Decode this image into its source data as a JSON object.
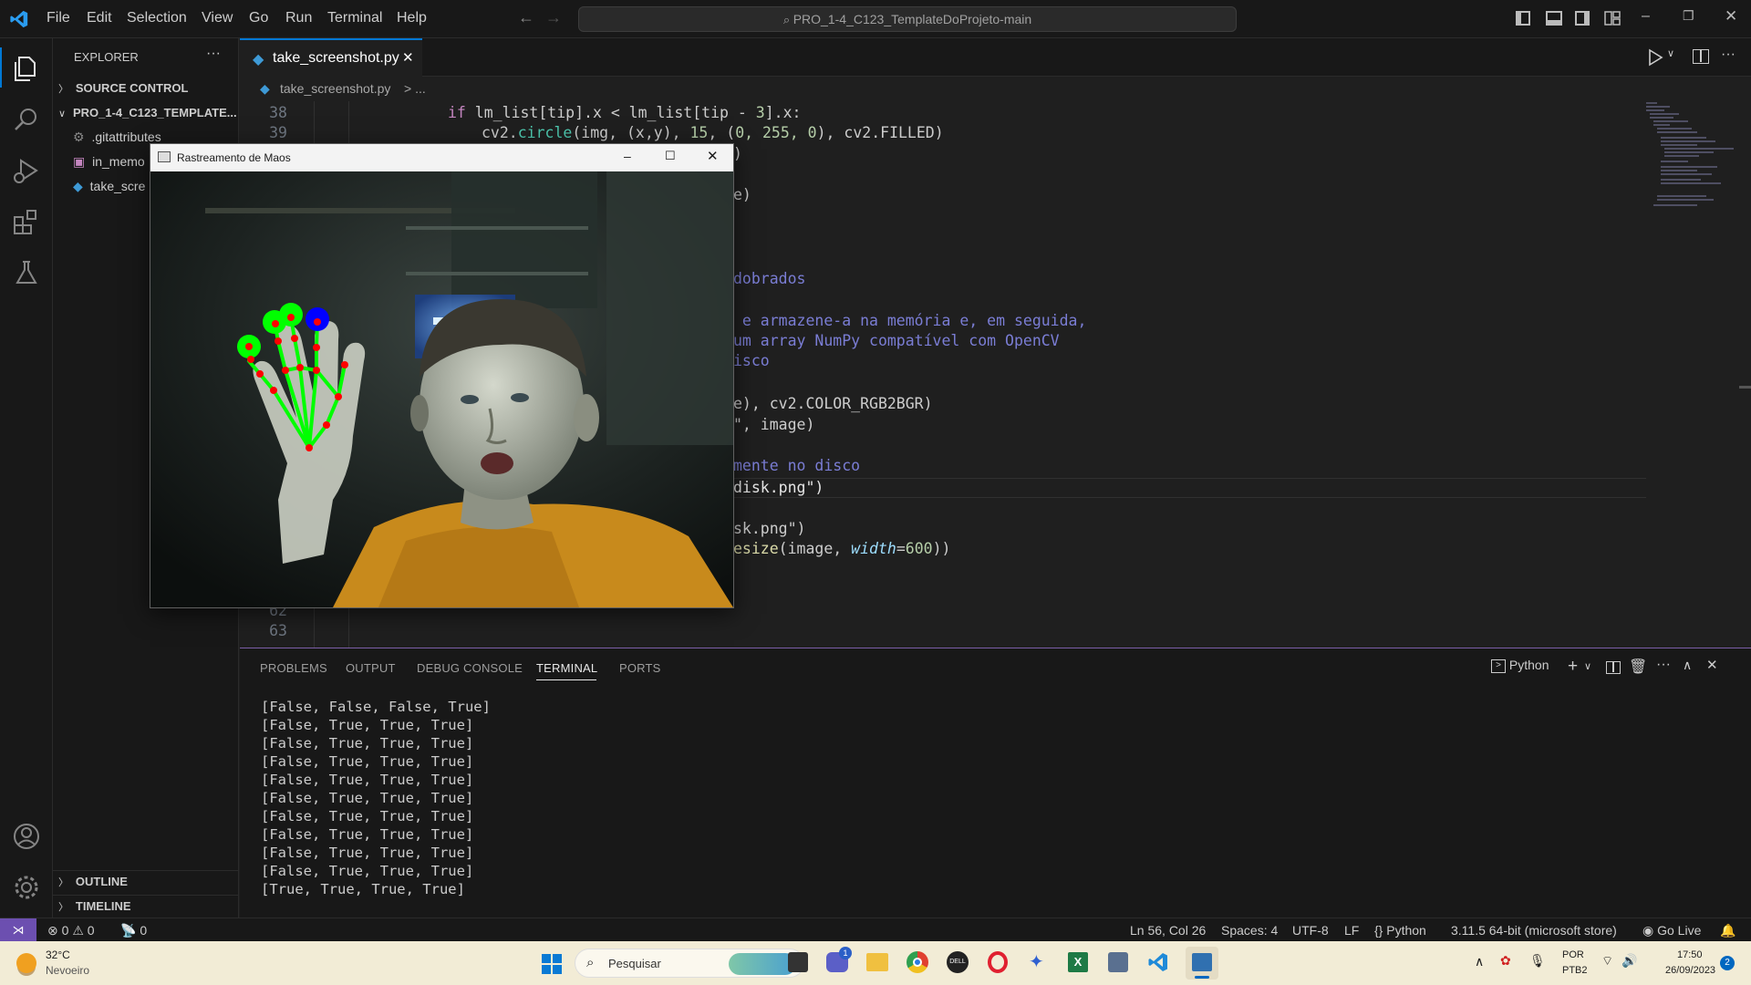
{
  "titlebar": {
    "menus": [
      "File",
      "Edit",
      "Selection",
      "View",
      "Go",
      "Run",
      "Terminal",
      "Help"
    ],
    "search_text": "PRO_1-4_C123_TemplateDoProjeto-main"
  },
  "sidebar": {
    "header": "EXPLORER",
    "more": "···",
    "source_control": "SOURCE CONTROL",
    "project": "PRO_1-4_C123_TEMPLATE...",
    "files": [
      ".gitattributes",
      "in_memo",
      "take_scre"
    ],
    "outline": "OUTLINE",
    "timeline": "TIMELINE"
  },
  "editor": {
    "tab_label": "take_screenshot.py",
    "breadcrumb_file": "take_screenshot.py",
    "breadcrumb_sep": "> ...",
    "line_numbers": [
      "38",
      "39",
      "62",
      "63"
    ],
    "code": {
      "l38_a": "if",
      "l38_b": " lm_list[tip].x < lm_list[tip - ",
      "l38_c": "3",
      "l38_d": "].x:",
      "l39_a": "cv2.",
      "l39_b": "circle",
      "l39_c": "(img, (x,y), ",
      "l39_d": "15",
      "l39_e": ", (",
      "l39_f": "0, 255, 0",
      "l39_g": "), cv2.FILLED)",
      "l40": ")",
      "l42": "e)",
      "l46": "dobrados",
      "l48": " e armazene-a na memória e, em seguida,",
      "l49": "um array NumPy compatível com OpenCV",
      "l50": "isco",
      "l52": "e), cv2.COLOR_RGB2BGR)",
      "l53": "\", image)",
      "l55": "mente no disco",
      "l56": "disk.png\")",
      "l58": "sk.png\")",
      "l59_a": "esize",
      "l59_b": "(image, ",
      "l59_c": "width",
      "l59_d": "=",
      "l59_e": "600",
      "l59_f": "))"
    }
  },
  "panel": {
    "tabs": [
      "PROBLEMS",
      "OUTPUT",
      "DEBUG CONSOLE",
      "TERMINAL",
      "PORTS"
    ],
    "active_tab": "TERMINAL",
    "shell": "Python",
    "output": [
      "[False, False, False, True]",
      "[False, True, True, True]",
      "[False, True, True, True]",
      "[False, True, True, True]",
      "[False, True, True, True]",
      "[False, True, True, True]",
      "[False, True, True, True]",
      "[False, True, True, True]",
      "[False, True, True, True]",
      "[False, True, True, True]",
      "[True, True, True, True]"
    ]
  },
  "statusbar": {
    "errors": "0",
    "warnings": "0",
    "ports": "0",
    "position": "Ln 56, Col 26",
    "spaces": "Spaces: 4",
    "encoding": "UTF-8",
    "eol": "LF",
    "language": "Python",
    "interpreter": "3.11.5 64-bit (microsoft store)",
    "golive": "Go Live"
  },
  "camera_window": {
    "title": "Rastreamento de Maos"
  },
  "taskbar": {
    "temperature": "32°C",
    "weather": "Nevoeiro",
    "search_placeholder": "Pesquisar",
    "lang_line1": "POR",
    "lang_line2": "PTB2",
    "time": "17:50",
    "date": "26/09/2023",
    "notif_count": "2",
    "teams_badge": "1"
  },
  "colors": {
    "accent": "#0078d4",
    "landmark_green": "#00ff00",
    "landmark_red": "#ff0000",
    "landmark_blue": "#0000ff"
  }
}
